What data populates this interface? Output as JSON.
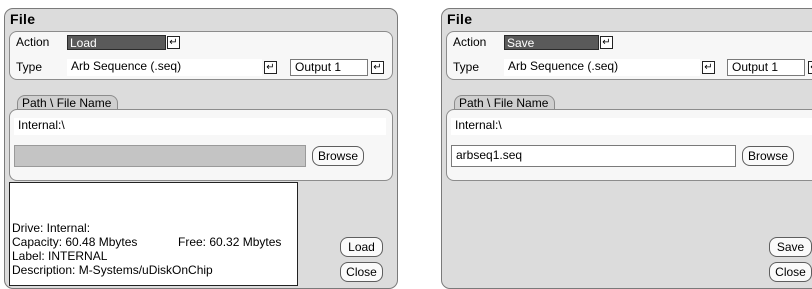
{
  "left": {
    "title": "File",
    "action_label": "Action",
    "action_value": "Load",
    "type_label": "Type",
    "type_value": "Arb Sequence (.seq)",
    "output_value": "Output 1",
    "path_tab": "Path \\ File Name",
    "path_value": "Internal:\\",
    "file_value": "",
    "browse_button": "Browse",
    "info": {
      "drive": "Drive: Internal:",
      "capacity": "Capacity: 60.48 Mbytes",
      "free": "Free: 60.32 Mbytes",
      "label": "Label: INTERNAL",
      "description": "Description: M-Systems/uDiskOnChip"
    },
    "load_button": "Load",
    "close_button": "Close"
  },
  "right": {
    "title": "File",
    "action_label": "Action",
    "action_value": "Save",
    "type_label": "Type",
    "type_value": "Arb Sequence (.seq)",
    "output_value": "Output 1",
    "path_tab": "Path \\ File Name",
    "path_value": "Internal:\\",
    "file_value": "arbseq1.seq",
    "browse_button": "Browse",
    "save_button": "Save",
    "close_button": "Close"
  },
  "icons": {
    "enter": "↵"
  }
}
